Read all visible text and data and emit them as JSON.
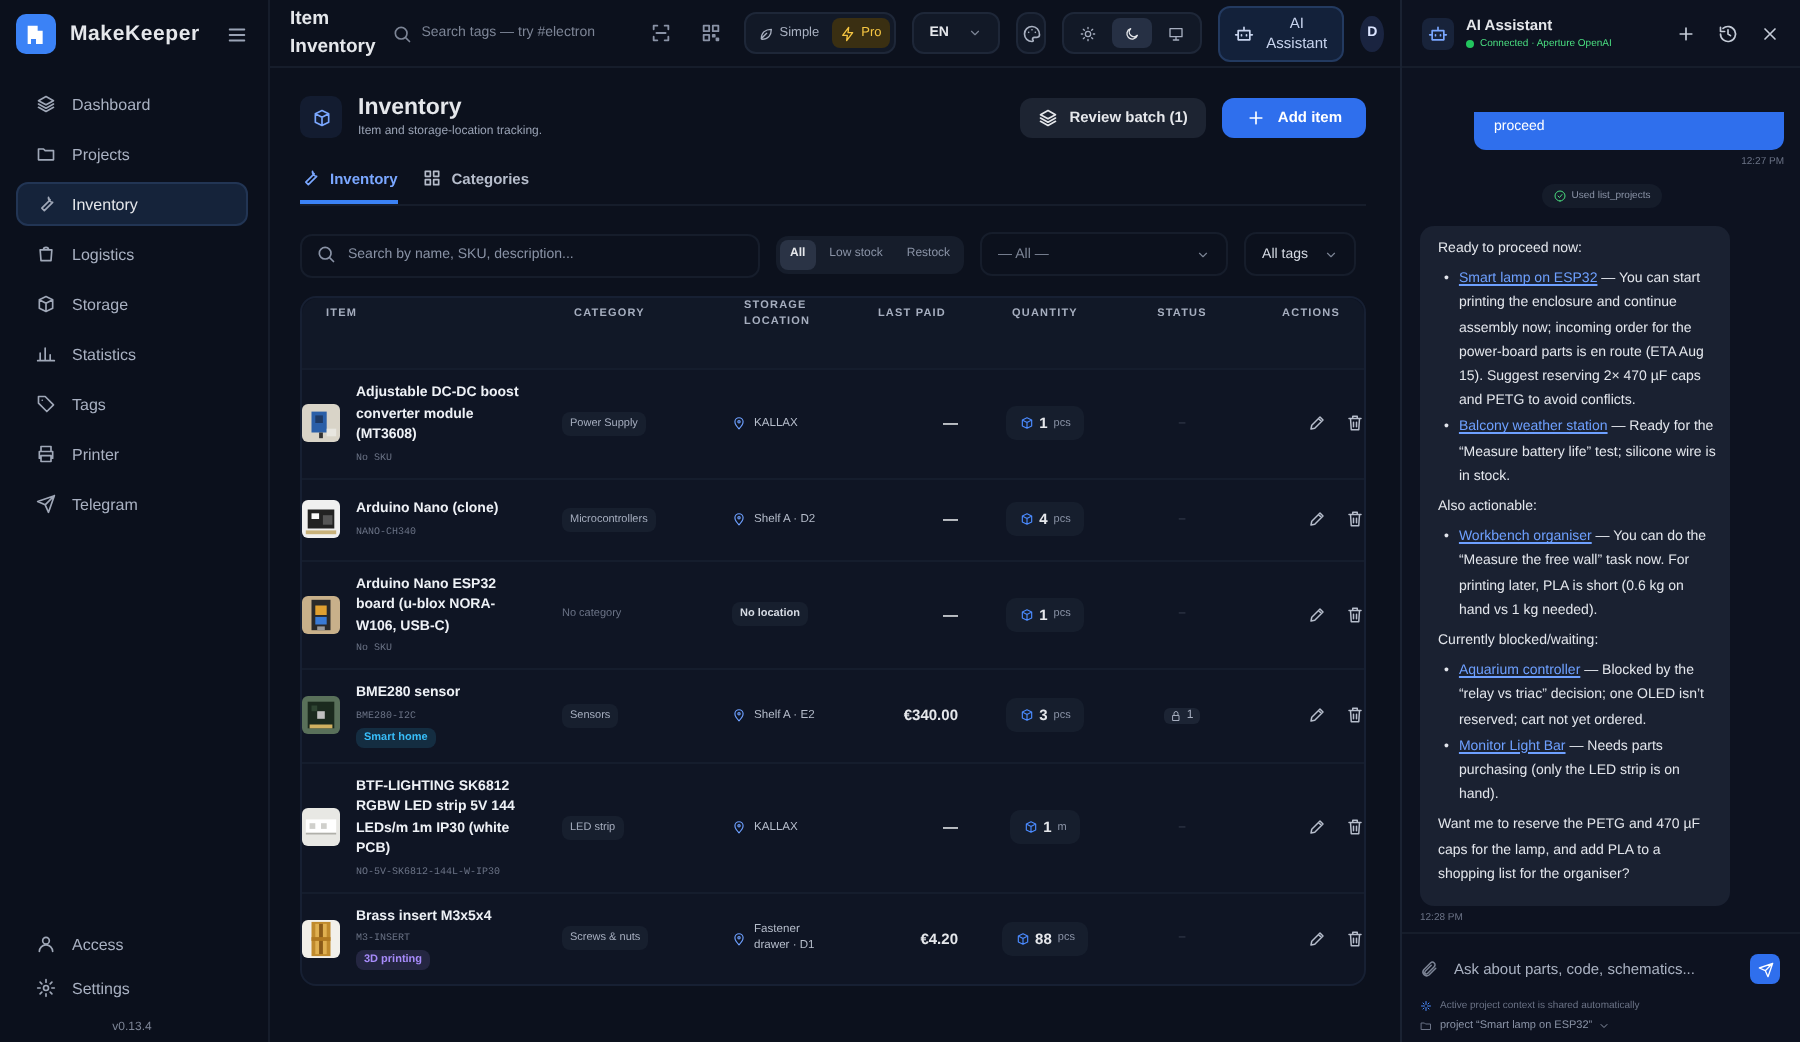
{
  "app": {
    "name": "MakeKeeper",
    "version": "v0.13.4"
  },
  "sidebar": {
    "items": [
      {
        "label": "Dashboard",
        "selected": false
      },
      {
        "label": "Projects",
        "selected": false
      },
      {
        "label": "Inventory",
        "selected": true
      },
      {
        "label": "Logistics",
        "selected": false
      },
      {
        "label": "Storage",
        "selected": false
      },
      {
        "label": "Statistics",
        "selected": false
      },
      {
        "label": "Tags",
        "selected": false
      },
      {
        "label": "Printer",
        "selected": false
      },
      {
        "label": "Telegram",
        "selected": false
      }
    ],
    "bottom_items": [
      {
        "label": "Access"
      },
      {
        "label": "Settings"
      }
    ]
  },
  "topbar": {
    "title": "Item Inventory",
    "search": {
      "placeholder": "Search tags — try #electron"
    },
    "modes": [
      {
        "label": "Simple",
        "selected": false
      },
      {
        "label": "Pro",
        "selected": true
      }
    ],
    "language": "EN",
    "themes": [
      {
        "selected": false
      },
      {
        "selected": true
      },
      {
        "selected": false
      }
    ],
    "assistant_button": {
      "label": "AI Assistant",
      "selected": true
    },
    "avatar": "D"
  },
  "page": {
    "title": "Inventory",
    "subtitle": "Item and storage-location tracking.",
    "buttons": [
      {
        "label": "Review batch (1)",
        "kind": "secondary"
      },
      {
        "label": "Add item",
        "kind": "primary"
      }
    ],
    "tabs": [
      {
        "label": "Inventory",
        "selected": true
      },
      {
        "label": "Categories",
        "selected": false
      }
    ]
  },
  "filters": {
    "search": {
      "placeholder": "Search by name, SKU, description..."
    },
    "stock": [
      {
        "label": "All",
        "selected": true
      },
      {
        "label": "Low stock",
        "selected": false
      },
      {
        "label": "Restock",
        "selected": false
      }
    ],
    "category": "— All —",
    "tags": "All tags"
  },
  "table": {
    "columns": [
      "ITEM",
      "CATEGORY",
      "STORAGE LOCATION",
      "LAST PAID",
      "QUANTITY",
      "STATUS",
      "ACTIONS"
    ],
    "rows": [
      {
        "name": "Adjustable DC-DC boost converter module (MT3608)",
        "sku": "No SKU",
        "category": {
          "kind": "tag",
          "text": "Power Supply"
        },
        "location": {
          "kind": "place",
          "text": "KALLAX"
        },
        "last_paid": "—",
        "quantity": "1",
        "unit": "pcs",
        "status": {
          "kind": "none",
          "text": "–"
        }
      },
      {
        "name": "Arduino Nano (clone)",
        "sku": "NANO-CH340",
        "category": {
          "kind": "tag",
          "text": "Microcontrollers"
        },
        "location": {
          "kind": "place",
          "text": "Shelf A · D2"
        },
        "last_paid": "—",
        "quantity": "4",
        "unit": "pcs",
        "status": {
          "kind": "none",
          "text": "–"
        }
      },
      {
        "name": "Arduino Nano ESP32 board (u-blox NORA-W106, USB-C)",
        "sku": "No SKU",
        "category": {
          "kind": "none",
          "text": "No category"
        },
        "location": {
          "kind": "none",
          "text": "No location"
        },
        "last_paid": "—",
        "quantity": "1",
        "unit": "pcs",
        "status": {
          "kind": "none",
          "text": "–"
        }
      },
      {
        "name": "BME280 sensor",
        "sku": "BME280-I2C",
        "tag": {
          "text": "Smart home",
          "color": "#38bdf8"
        },
        "category": {
          "kind": "tag",
          "text": "Sensors"
        },
        "location": {
          "kind": "place",
          "text": "Shelf A · E2"
        },
        "last_paid": "€340.00",
        "quantity": "3",
        "unit": "pcs",
        "status": {
          "kind": "reserved",
          "text": "1"
        }
      },
      {
        "name": "BTF-LIGHTING SK6812 RGBW LED strip 5V 144 LEDs/m 1m IP30 (white PCB)",
        "sku": "NO-5V-SK6812-144L-W-IP30",
        "category": {
          "kind": "tag",
          "text": "LED strip"
        },
        "location": {
          "kind": "place",
          "text": "KALLAX"
        },
        "last_paid": "—",
        "quantity": "1",
        "unit": "m",
        "status": {
          "kind": "none",
          "text": "–"
        }
      },
      {
        "name": "Brass insert M3x5x4",
        "sku": "M3-INSERT",
        "tag": {
          "text": "3D printing",
          "color": "#a78bfa"
        },
        "category": {
          "kind": "tag",
          "text": "Screws & nuts"
        },
        "location": {
          "kind": "place",
          "text": "Fastener drawer · D1"
        },
        "last_paid": "€4.20",
        "quantity": "88",
        "unit": "pcs",
        "status": {
          "kind": "none",
          "text": "–"
        }
      }
    ]
  },
  "assistant": {
    "title": "AI Assistant",
    "status": "Connected · Aperture OpenAI",
    "connected": true,
    "messages": [
      {
        "kind": "user",
        "text": "proceed",
        "time": "12:27 PM"
      },
      {
        "kind": "tool",
        "text": "Used list_projects"
      },
      {
        "kind": "assistant",
        "time": "12:28 PM",
        "blocks": [
          {
            "kind": "p",
            "text": "Ready to proceed now:"
          },
          {
            "kind": "list",
            "items": [
              {
                "bullet": "•",
                "link": "Smart lamp on ESP32",
                "text": " — You can start printing the enclosure and continue assembly now; incoming order for the power-board parts is en route (ETA Aug 15). Suggest reserving 2× 470 µF caps and PETG to avoid conflicts."
              },
              {
                "bullet": "•",
                "link": "Balcony weather station",
                "text": " — Ready for the “Measure battery life” test; silicone wire is in stock."
              }
            ]
          },
          {
            "kind": "p",
            "text": "Also actionable:"
          },
          {
            "kind": "list",
            "items": [
              {
                "bullet": "•",
                "link": "Workbench organiser",
                "text": " — You can do the “Measure the free wall” task now. For printing later, PLA is short (0.6 kg on hand vs 1 kg needed)."
              }
            ]
          },
          {
            "kind": "p",
            "text": "Currently blocked/waiting:"
          },
          {
            "kind": "list",
            "items": [
              {
                "bullet": "•",
                "link": "Aquarium controller",
                "text": " — Blocked by the “relay vs triac” decision; one OLED isn’t reserved; cart not yet ordered."
              },
              {
                "bullet": "•",
                "link": "Monitor Light Bar",
                "text": " — Needs parts purchasing (only the LED strip is on hand)."
              }
            ]
          },
          {
            "kind": "p",
            "text": "Want me to reserve the PETG and 470 µF caps for the lamp, and add PLA to a shopping list for the organiser?"
          }
        ]
      }
    ]
  },
  "composer": {
    "placeholder": "Ask about parts, code, schematics..."
  },
  "footer": {
    "note": "Active project context is shared automatically",
    "project": "project “Smart lamp on ESP32”"
  }
}
